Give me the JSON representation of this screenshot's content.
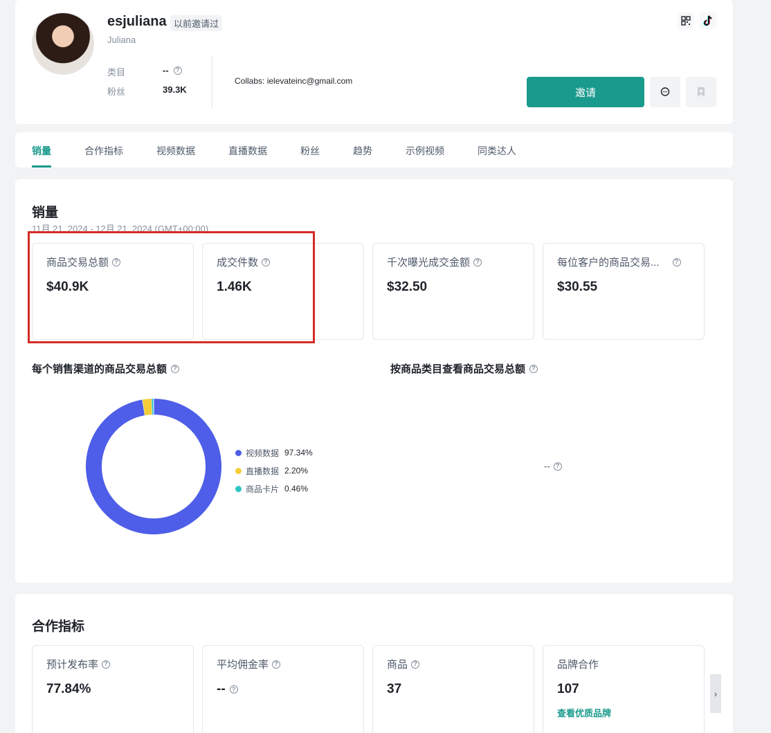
{
  "profile": {
    "username": "esjuliana",
    "invited_tag": "以前邀请过",
    "display_name": "Juliana",
    "category_label": "类目",
    "category_value": "--",
    "followers_label": "粉丝",
    "followers_value": "39.3K",
    "collabs": "Collabs: ielevateinc@gmail.com",
    "invite_label": "邀请",
    "icons": [
      "qr-code-icon",
      "tiktok-icon",
      "message-icon",
      "bookmark-icon"
    ]
  },
  "tabs": [
    "销量",
    "合作指标",
    "视频数据",
    "直播数据",
    "粉丝",
    "趋势",
    "示例视频",
    "同类达人"
  ],
  "active_tab": "销量",
  "sales": {
    "title": "销量",
    "date_range": "11月 21, 2024 - 12月 21, 2024 (GMT+00:00)",
    "metrics": [
      {
        "label": "商品交易总额",
        "value": "$40.9K"
      },
      {
        "label": "成交件数",
        "value": "1.46K"
      },
      {
        "label": "千次曝光成交金额",
        "value": "$32.50"
      },
      {
        "label": "每位客户的商品交易...",
        "value": "$30.55"
      }
    ],
    "channel_title": "每个销售渠道的商品交易总额",
    "category_title": "按商品类目查看商品交易总额",
    "category_empty": "--"
  },
  "chart_data": {
    "type": "pie",
    "categories": [
      "视频数据",
      "直播数据",
      "商品卡片"
    ],
    "values": [
      97.34,
      2.2,
      0.46
    ],
    "labels": [
      "97.34%",
      "2.20%",
      "0.46%"
    ],
    "colors": [
      "#4e5ee8",
      "#f5cd37",
      "#2ec4c4"
    ],
    "legend": "right"
  },
  "coop": {
    "title": "合作指标",
    "metrics": [
      {
        "label": "预计发布率",
        "value": "77.84%"
      },
      {
        "label": "平均佣金率",
        "value": "--"
      },
      {
        "label": "商品",
        "value": "37"
      },
      {
        "label": "品牌合作",
        "value": "107"
      }
    ],
    "brand_link": "查看优质品牌"
  },
  "colors": {
    "accent": "#1a9a8c",
    "highlight_border": "#d52b26"
  }
}
